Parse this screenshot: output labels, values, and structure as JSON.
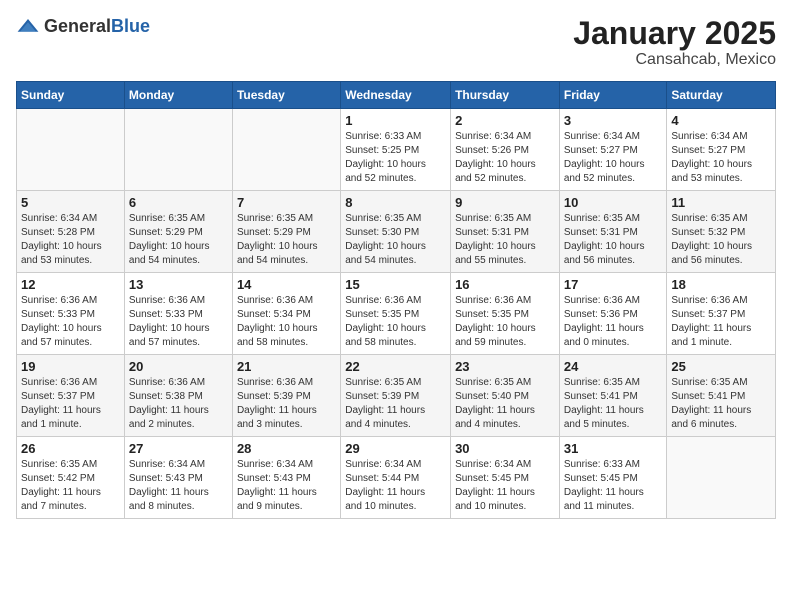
{
  "header": {
    "logo_general": "General",
    "logo_blue": "Blue",
    "title": "January 2025",
    "subtitle": "Cansahcab, Mexico"
  },
  "weekdays": [
    "Sunday",
    "Monday",
    "Tuesday",
    "Wednesday",
    "Thursday",
    "Friday",
    "Saturday"
  ],
  "weeks": [
    [
      {
        "day": "",
        "info": ""
      },
      {
        "day": "",
        "info": ""
      },
      {
        "day": "",
        "info": ""
      },
      {
        "day": "1",
        "info": "Sunrise: 6:33 AM\nSunset: 5:25 PM\nDaylight: 10 hours\nand 52 minutes."
      },
      {
        "day": "2",
        "info": "Sunrise: 6:34 AM\nSunset: 5:26 PM\nDaylight: 10 hours\nand 52 minutes."
      },
      {
        "day": "3",
        "info": "Sunrise: 6:34 AM\nSunset: 5:27 PM\nDaylight: 10 hours\nand 52 minutes."
      },
      {
        "day": "4",
        "info": "Sunrise: 6:34 AM\nSunset: 5:27 PM\nDaylight: 10 hours\nand 53 minutes."
      }
    ],
    [
      {
        "day": "5",
        "info": "Sunrise: 6:34 AM\nSunset: 5:28 PM\nDaylight: 10 hours\nand 53 minutes."
      },
      {
        "day": "6",
        "info": "Sunrise: 6:35 AM\nSunset: 5:29 PM\nDaylight: 10 hours\nand 54 minutes."
      },
      {
        "day": "7",
        "info": "Sunrise: 6:35 AM\nSunset: 5:29 PM\nDaylight: 10 hours\nand 54 minutes."
      },
      {
        "day": "8",
        "info": "Sunrise: 6:35 AM\nSunset: 5:30 PM\nDaylight: 10 hours\nand 54 minutes."
      },
      {
        "day": "9",
        "info": "Sunrise: 6:35 AM\nSunset: 5:31 PM\nDaylight: 10 hours\nand 55 minutes."
      },
      {
        "day": "10",
        "info": "Sunrise: 6:35 AM\nSunset: 5:31 PM\nDaylight: 10 hours\nand 56 minutes."
      },
      {
        "day": "11",
        "info": "Sunrise: 6:35 AM\nSunset: 5:32 PM\nDaylight: 10 hours\nand 56 minutes."
      }
    ],
    [
      {
        "day": "12",
        "info": "Sunrise: 6:36 AM\nSunset: 5:33 PM\nDaylight: 10 hours\nand 57 minutes."
      },
      {
        "day": "13",
        "info": "Sunrise: 6:36 AM\nSunset: 5:33 PM\nDaylight: 10 hours\nand 57 minutes."
      },
      {
        "day": "14",
        "info": "Sunrise: 6:36 AM\nSunset: 5:34 PM\nDaylight: 10 hours\nand 58 minutes."
      },
      {
        "day": "15",
        "info": "Sunrise: 6:36 AM\nSunset: 5:35 PM\nDaylight: 10 hours\nand 58 minutes."
      },
      {
        "day": "16",
        "info": "Sunrise: 6:36 AM\nSunset: 5:35 PM\nDaylight: 10 hours\nand 59 minutes."
      },
      {
        "day": "17",
        "info": "Sunrise: 6:36 AM\nSunset: 5:36 PM\nDaylight: 11 hours\nand 0 minutes."
      },
      {
        "day": "18",
        "info": "Sunrise: 6:36 AM\nSunset: 5:37 PM\nDaylight: 11 hours\nand 1 minute."
      }
    ],
    [
      {
        "day": "19",
        "info": "Sunrise: 6:36 AM\nSunset: 5:37 PM\nDaylight: 11 hours\nand 1 minute."
      },
      {
        "day": "20",
        "info": "Sunrise: 6:36 AM\nSunset: 5:38 PM\nDaylight: 11 hours\nand 2 minutes."
      },
      {
        "day": "21",
        "info": "Sunrise: 6:36 AM\nSunset: 5:39 PM\nDaylight: 11 hours\nand 3 minutes."
      },
      {
        "day": "22",
        "info": "Sunrise: 6:35 AM\nSunset: 5:39 PM\nDaylight: 11 hours\nand 4 minutes."
      },
      {
        "day": "23",
        "info": "Sunrise: 6:35 AM\nSunset: 5:40 PM\nDaylight: 11 hours\nand 4 minutes."
      },
      {
        "day": "24",
        "info": "Sunrise: 6:35 AM\nSunset: 5:41 PM\nDaylight: 11 hours\nand 5 minutes."
      },
      {
        "day": "25",
        "info": "Sunrise: 6:35 AM\nSunset: 5:41 PM\nDaylight: 11 hours\nand 6 minutes."
      }
    ],
    [
      {
        "day": "26",
        "info": "Sunrise: 6:35 AM\nSunset: 5:42 PM\nDaylight: 11 hours\nand 7 minutes."
      },
      {
        "day": "27",
        "info": "Sunrise: 6:34 AM\nSunset: 5:43 PM\nDaylight: 11 hours\nand 8 minutes."
      },
      {
        "day": "28",
        "info": "Sunrise: 6:34 AM\nSunset: 5:43 PM\nDaylight: 11 hours\nand 9 minutes."
      },
      {
        "day": "29",
        "info": "Sunrise: 6:34 AM\nSunset: 5:44 PM\nDaylight: 11 hours\nand 10 minutes."
      },
      {
        "day": "30",
        "info": "Sunrise: 6:34 AM\nSunset: 5:45 PM\nDaylight: 11 hours\nand 10 minutes."
      },
      {
        "day": "31",
        "info": "Sunrise: 6:33 AM\nSunset: 5:45 PM\nDaylight: 11 hours\nand 11 minutes."
      },
      {
        "day": "",
        "info": ""
      }
    ]
  ]
}
